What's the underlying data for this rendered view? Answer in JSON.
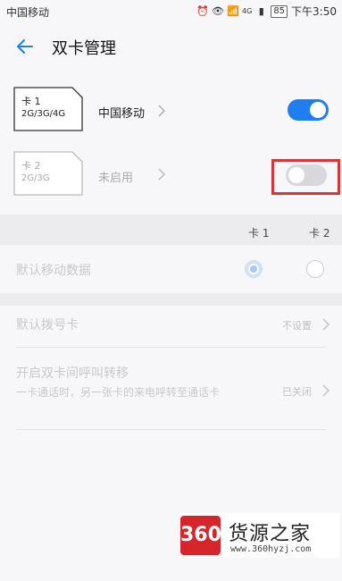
{
  "status_bar": {
    "carrier": "中国移动",
    "signal_label": "4G",
    "battery": "85",
    "time": "下午3:50"
  },
  "header": {
    "title": "双卡管理"
  },
  "sims": [
    {
      "name": "卡 1",
      "network": "2G/3G/4G",
      "operator": "中国移动",
      "enabled": true
    },
    {
      "name": "卡 2",
      "network": "2G/3G",
      "operator": "未启用",
      "enabled": false
    }
  ],
  "columns": {
    "sim1": "卡 1",
    "sim2": "卡 2"
  },
  "settings": {
    "default_data": {
      "label": "默认移动数据",
      "selected": "卡 1"
    },
    "default_dial": {
      "label": "默认拨号卡",
      "value": "不设置"
    },
    "call_forward": {
      "label": "开启双卡间呼叫转移",
      "description": "一卡通话时，另一张卡的来电呼转至通话卡",
      "value": "已关闭"
    }
  },
  "watermark": {
    "badge": "360",
    "title": "货源之家",
    "url": "www.360hyzj.com"
  },
  "colors": {
    "accent": "#1f7ef0",
    "toggle_off": "#d8d8dc",
    "highlight": "#d9343a",
    "brand_red": "#d6262c"
  }
}
